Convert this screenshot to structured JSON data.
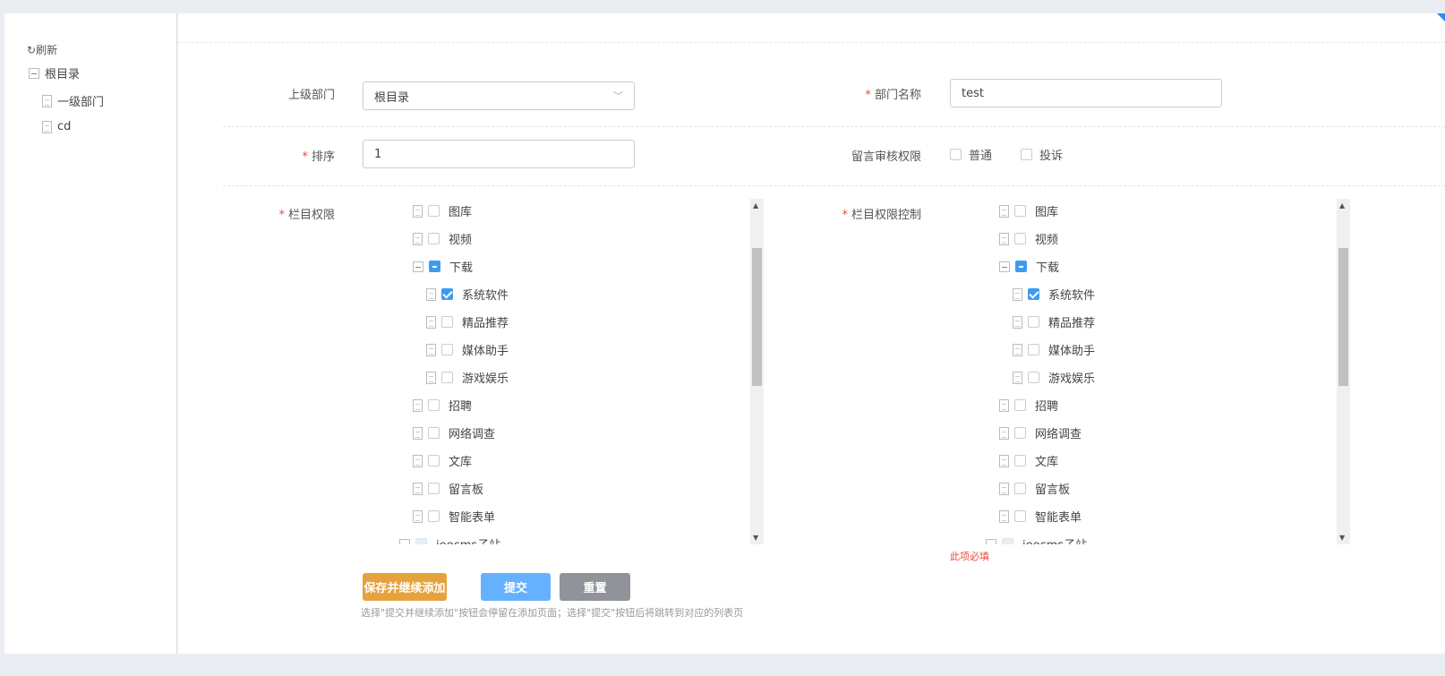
{
  "sidebar": {
    "refresh": "刷新",
    "root": "根目录",
    "children": [
      "一级部门",
      "cd"
    ]
  },
  "form": {
    "parent_label": "上级部门",
    "parent_value": "根目录",
    "name_label": "部门名称",
    "name_value": "test",
    "sort_label": "排序",
    "sort_value": "1",
    "review_label": "留言审核权限",
    "review_options": [
      "普通",
      "投诉"
    ],
    "channel_label": "栏目权限",
    "channel_control_label": "栏目权限控制",
    "required_msg": "此项必填"
  },
  "tree": [
    {
      "label": "图库",
      "level": 1,
      "type": "leaf",
      "state": "none"
    },
    {
      "label": "视频",
      "level": 1,
      "type": "leaf",
      "state": "none"
    },
    {
      "label": "下载",
      "level": 1,
      "type": "expanded",
      "state": "indeterminate"
    },
    {
      "label": "系统软件",
      "level": 2,
      "type": "leaf",
      "state": "checked"
    },
    {
      "label": "精品推荐",
      "level": 2,
      "type": "leaf",
      "state": "none"
    },
    {
      "label": "媒体助手",
      "level": 2,
      "type": "leaf",
      "state": "none"
    },
    {
      "label": "游戏娱乐",
      "level": 2,
      "type": "leaf",
      "state": "none"
    },
    {
      "label": "招聘",
      "level": 1,
      "type": "leaf",
      "state": "none"
    },
    {
      "label": "网络调查",
      "level": 1,
      "type": "leaf",
      "state": "none"
    },
    {
      "label": "文库",
      "level": 1,
      "type": "leaf",
      "state": "none"
    },
    {
      "label": "留言板",
      "level": 1,
      "type": "leaf",
      "state": "none"
    },
    {
      "label": "智能表单",
      "level": 1,
      "type": "leaf",
      "state": "none"
    },
    {
      "label": "jeecms子站",
      "level": 0,
      "type": "expanded",
      "state": "disabled"
    }
  ],
  "buttons": {
    "save_continue": "保存并继续添加",
    "submit": "提交",
    "reset": "重置"
  },
  "hint": "选择\"提交并继续添加\"按钮会停留在添加页面；选择\"提交\"按钮后将跳转到对应的列表页",
  "colors": {
    "save": "#e6a23c",
    "submit": "#66b1ff",
    "reset": "#909399",
    "accent": "#3c9cf0",
    "required": "#e84c3d"
  }
}
